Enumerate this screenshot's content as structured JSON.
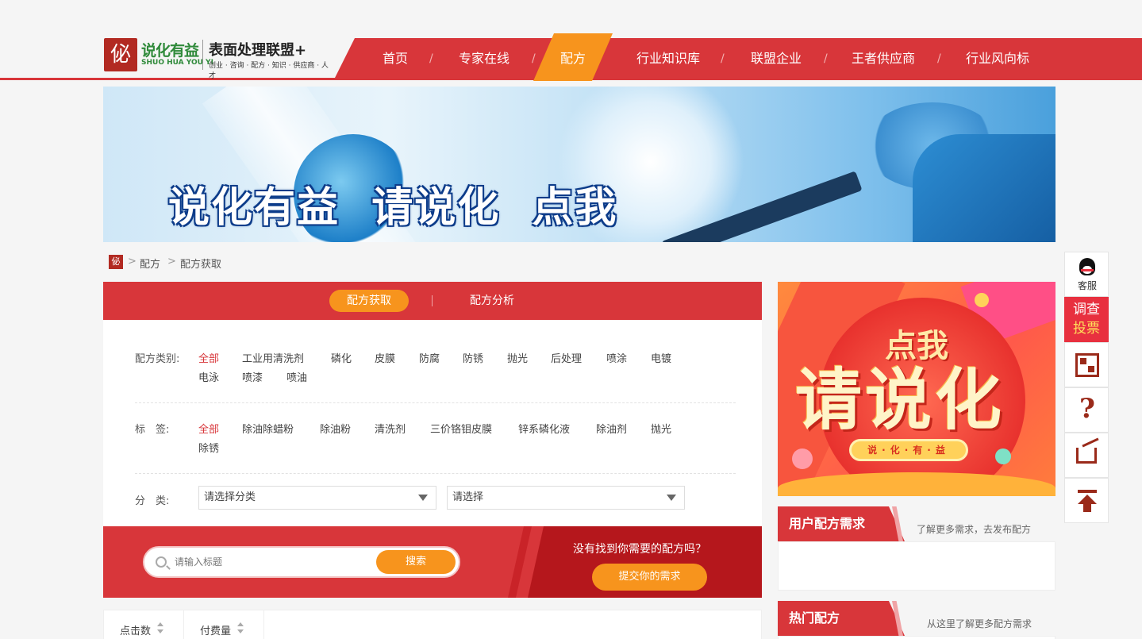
{
  "logo": {
    "seal": "佖",
    "name_cn": "说化有益",
    "name_pinyin": "SHUO HUA YOU YI",
    "alliance": "表面处理联盟+",
    "tagline": "创业 · 咨询 · 配方 · 知识 · 供应商 · 人才"
  },
  "nav": {
    "items": [
      "首页",
      "专家在线",
      "配方",
      "行业知识库",
      "联盟企业",
      "王者供应商",
      "行业风向标"
    ],
    "active": "配方",
    "separator": "/"
  },
  "banner": {
    "slogan": "说化有益  请说化  点我"
  },
  "breadcrumb": {
    "icon": "佖",
    "items": [
      "配方",
      "配方获取"
    ],
    "separator": ">"
  },
  "tabs": {
    "active": "配方获取",
    "other": "配方分析"
  },
  "filters": {
    "category": {
      "label": "配方类别:",
      "items": [
        "全部",
        "工业用清洗剂",
        "磷化",
        "皮膜",
        "防腐",
        "防锈",
        "抛光",
        "后处理",
        "喷涂",
        "电镀",
        "电泳",
        "喷漆",
        "喷油"
      ]
    },
    "tags": {
      "label": "标　签:",
      "items": [
        "全部",
        "除油除蜡粉",
        "除油粉",
        "清洗剂",
        "三价铬钼皮膜",
        "锌系磷化液",
        "除油剂",
        "抛光",
        "除锈"
      ]
    },
    "classify": {
      "label": "分　类:",
      "select1": "请选择分类",
      "select2": "请选择"
    }
  },
  "search": {
    "placeholder": "请输入标题",
    "button": "搜索",
    "notfound": "没有找到你需要的配方吗？",
    "submit": "提交你的需求"
  },
  "list": {
    "columns": [
      "点击数",
      "付费量"
    ]
  },
  "ad": {
    "line1": "点我",
    "line2": "请说化",
    "pill": "说·化·有·益"
  },
  "side": {
    "demand": {
      "title": "用户配方需求",
      "note": "了解更多需求，去发布配方"
    },
    "hot": {
      "title": "热门配方",
      "note": "从这里了解更多配方需求"
    }
  },
  "float": {
    "service": "客服",
    "vote1": "调查",
    "vote2": "投票",
    "help": "?"
  },
  "colors": {
    "brand_red": "#d8363a",
    "accent_orange": "#f7941d",
    "logo_green": "#2f8a3a"
  }
}
